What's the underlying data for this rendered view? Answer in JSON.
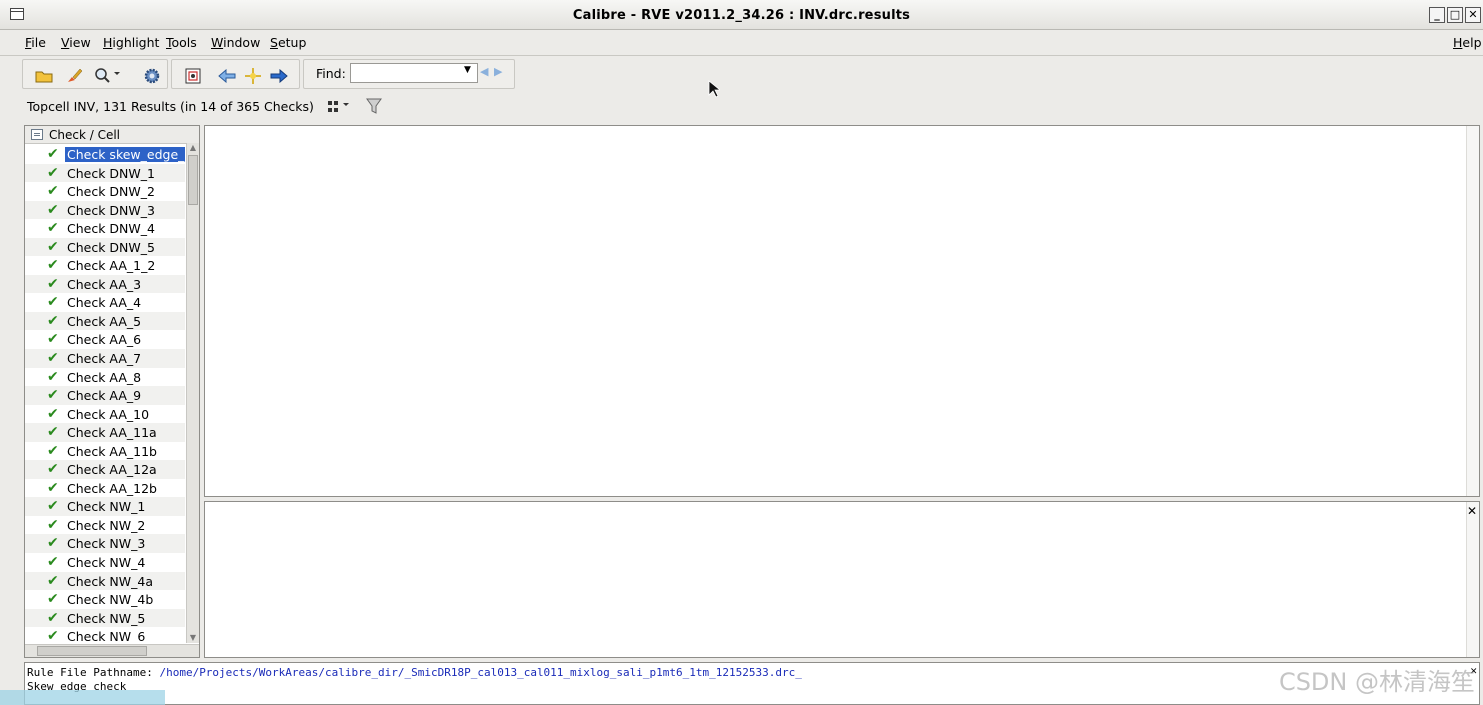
{
  "window": {
    "title": "Calibre - RVE v2011.2_34.26 : INV.drc.results",
    "buttons": [
      "_",
      "□",
      "✕"
    ]
  },
  "menu": {
    "items": [
      "File",
      "View",
      "Highlight",
      "Tools",
      "Window",
      "Setup"
    ],
    "help": "Help"
  },
  "toolbar": {
    "find_label": "Find:",
    "find_value": "",
    "icons": [
      "open-folder-icon",
      "highlight-brush-icon",
      "zoom-search-icon",
      "settings-gear-icon",
      "show-all-icon",
      "back-arrow-icon",
      "center-crosshair-icon",
      "forward-arrow-icon",
      "find-prev-icon",
      "find-next-icon"
    ]
  },
  "summary": {
    "text": "Topcell INV, 131 Results (in 14 of 365 Checks)"
  },
  "tree": {
    "header": "Check / Cell",
    "items": [
      {
        "label": "Check skew_edge_c",
        "selected": true
      },
      {
        "label": "Check DNW_1"
      },
      {
        "label": "Check DNW_2"
      },
      {
        "label": "Check DNW_3"
      },
      {
        "label": "Check DNW_4"
      },
      {
        "label": "Check DNW_5"
      },
      {
        "label": "Check AA_1_2"
      },
      {
        "label": "Check AA_3"
      },
      {
        "label": "Check AA_4"
      },
      {
        "label": "Check AA_5"
      },
      {
        "label": "Check AA_6"
      },
      {
        "label": "Check AA_7"
      },
      {
        "label": "Check AA_8"
      },
      {
        "label": "Check AA_9"
      },
      {
        "label": "Check AA_10"
      },
      {
        "label": "Check AA_11a"
      },
      {
        "label": "Check AA_11b"
      },
      {
        "label": "Check AA_12a"
      },
      {
        "label": "Check AA_12b"
      },
      {
        "label": "Check NW_1"
      },
      {
        "label": "Check NW_2"
      },
      {
        "label": "Check NW_3"
      },
      {
        "label": "Check NW_4"
      },
      {
        "label": "Check NW_4a"
      },
      {
        "label": "Check NW_4b"
      },
      {
        "label": "Check NW_5"
      },
      {
        "label": "Check NW_6"
      }
    ]
  },
  "status": {
    "line1_label": "Rule File Pathname: ",
    "line1_path": "/home/Projects/WorkAreas/calibre_dir/_SmicDR18P_cal013_cal011_mixlog_sali_p1mt6_1tm_12152533.drc_",
    "line2": "Skew edge check"
  },
  "watermark": "CSDN @林清海笙",
  "colors": {
    "selection": "#2d62c7",
    "check_green": "#2a8a1e",
    "path_blue": "#1a2bb8"
  }
}
